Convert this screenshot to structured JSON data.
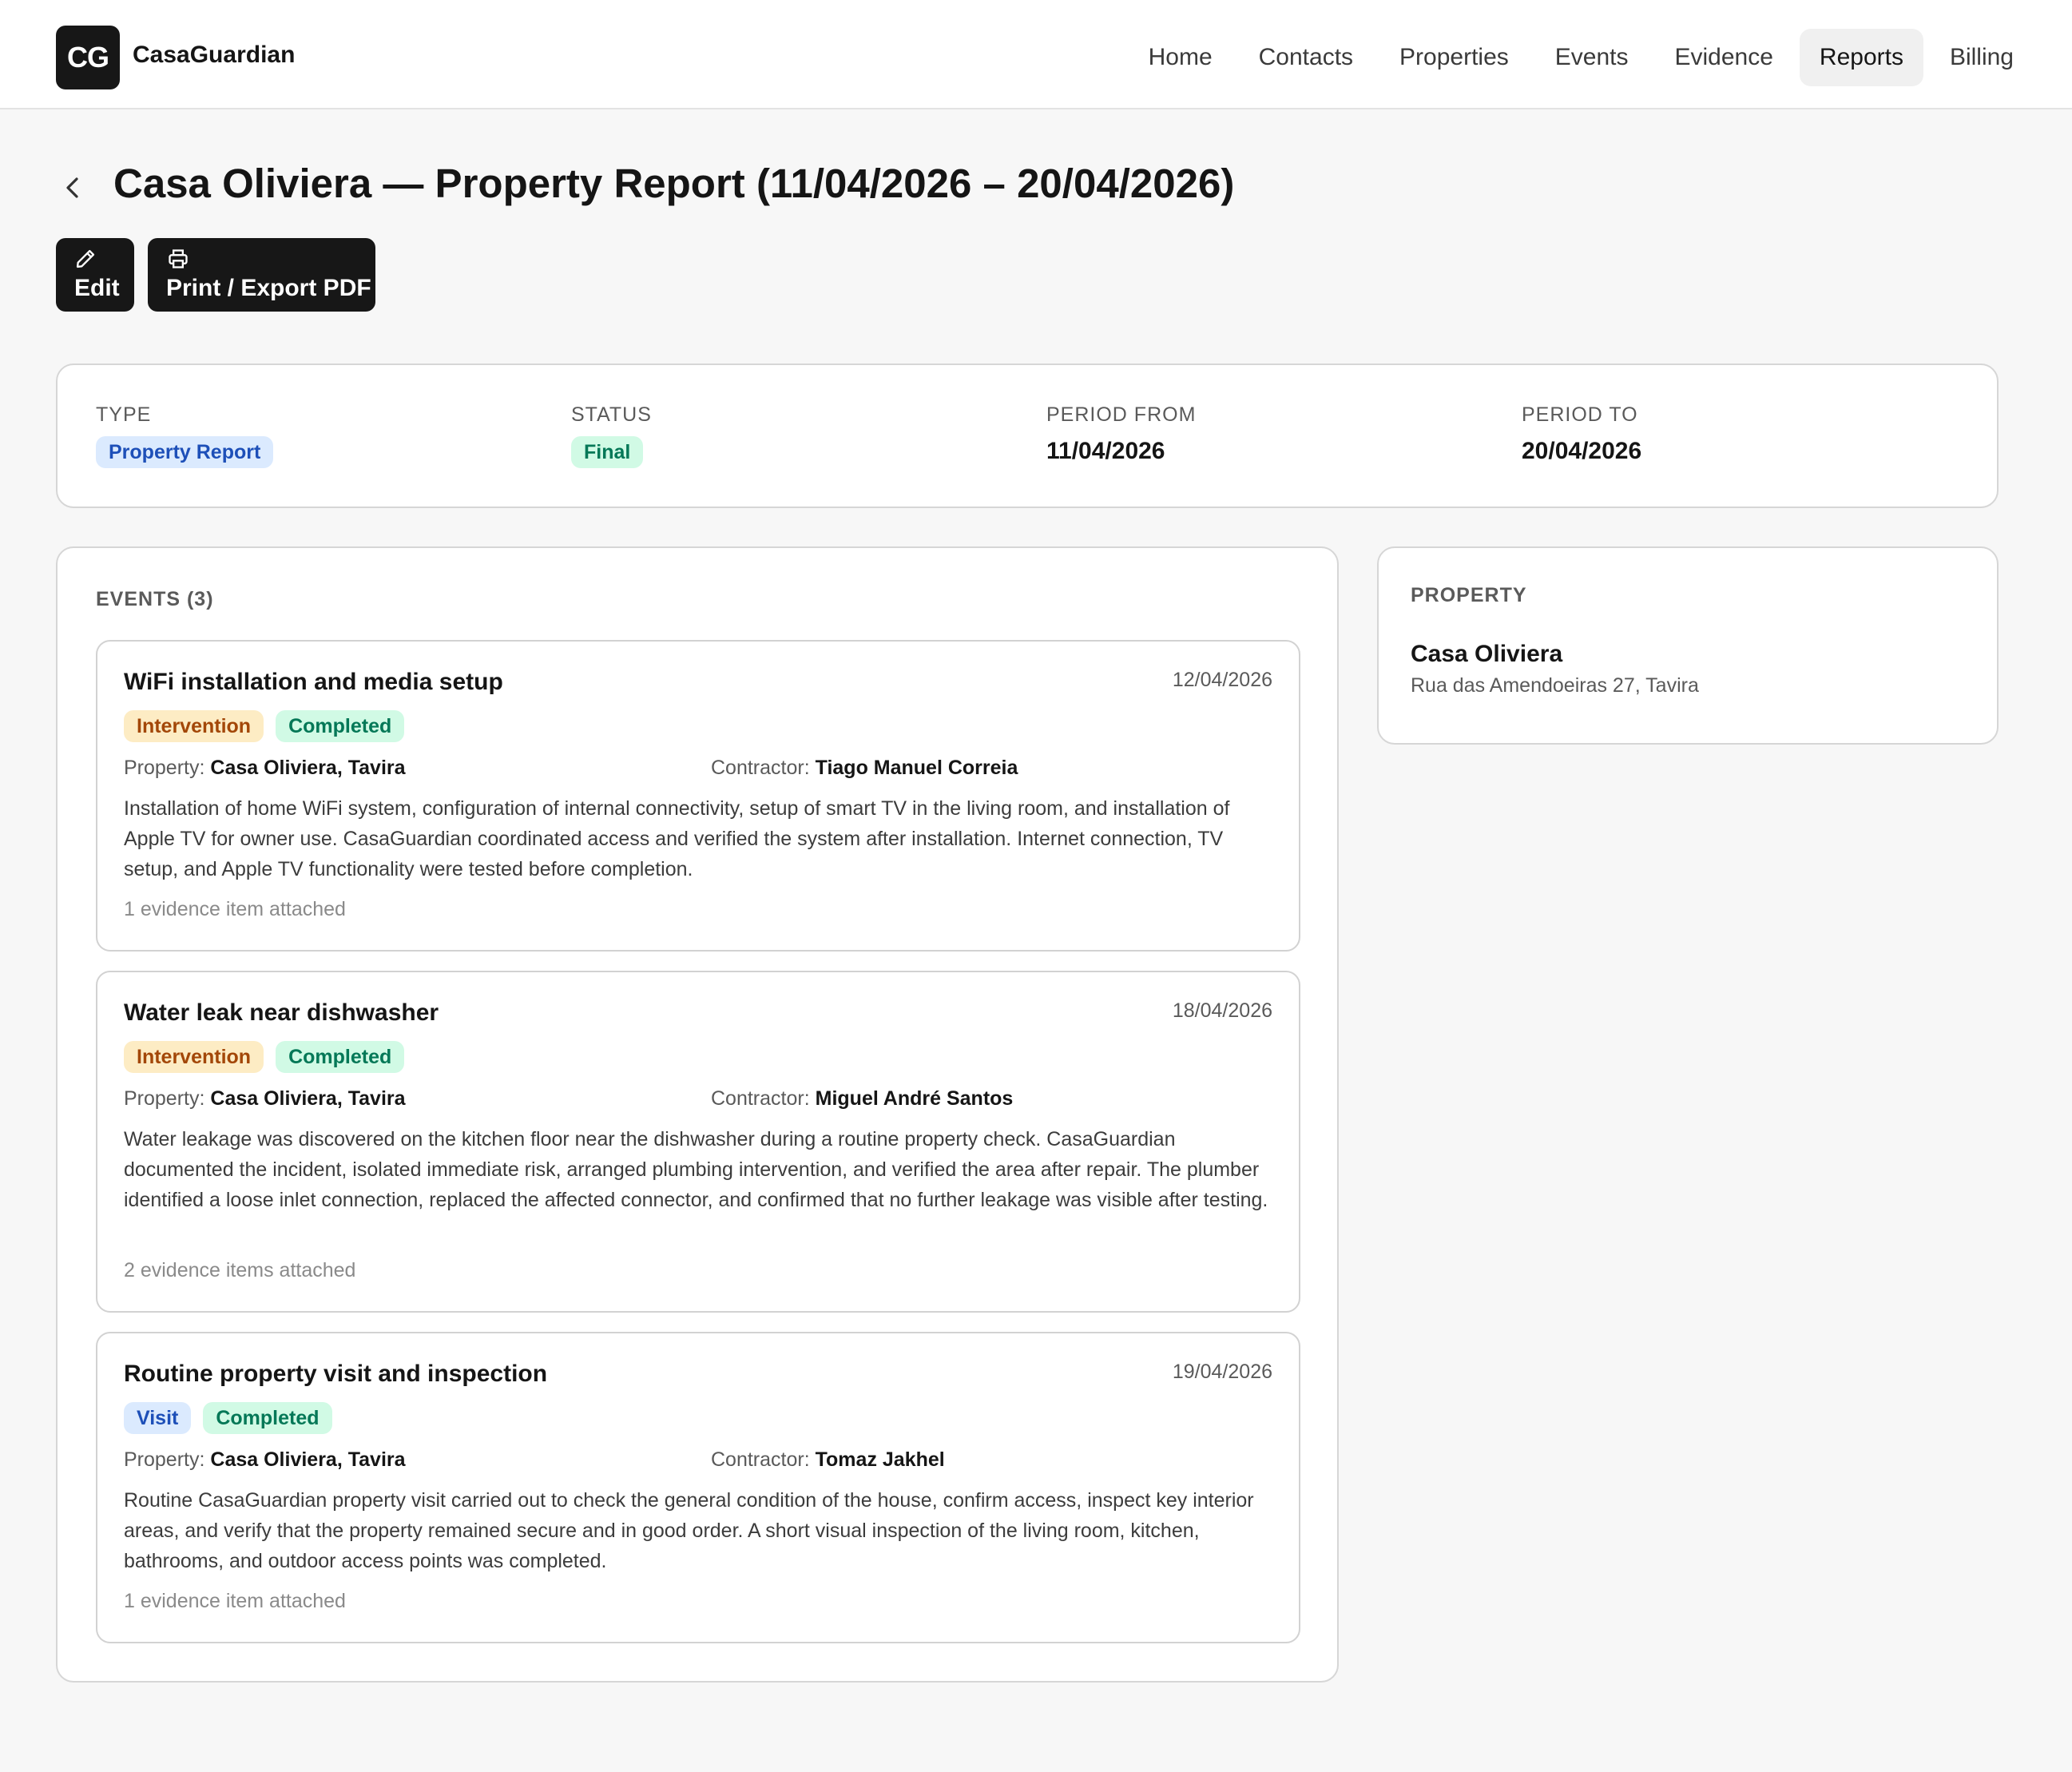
{
  "app": {
    "logo_text": "CG",
    "brand": "CasaGuardian"
  },
  "nav": {
    "items": [
      {
        "label": "Home"
      },
      {
        "label": "Contacts"
      },
      {
        "label": "Properties"
      },
      {
        "label": "Events"
      },
      {
        "label": "Evidence"
      },
      {
        "label": "Reports",
        "active": true
      },
      {
        "label": "Billing"
      }
    ]
  },
  "header": {
    "back_icon": "chevron-left-icon",
    "title": "Casa Oliviera — Property Report (11/04/2026 – 20/04/2026)",
    "edit_label": "Edit",
    "edit_icon": "pencil-icon",
    "print_label": "Print / Export PDF",
    "print_icon": "printer-icon"
  },
  "summary": {
    "type_label": "TYPE",
    "type_value": "Property Report",
    "status_label": "STATUS",
    "status_value": "Final",
    "period_from_label": "PERIOD FROM",
    "period_from_value": "11/04/2026",
    "period_to_label": "PERIOD TO",
    "period_to_value": "20/04/2026"
  },
  "events": {
    "heading": "EVENTS (3)",
    "property_label": "Property:",
    "contractor_label": "Contractor:",
    "items": [
      {
        "title": "WiFi installation and media setup",
        "date": "12/04/2026",
        "category": "Intervention",
        "status": "Completed",
        "property": "Casa Oliviera, Tavira",
        "contractor": "Tiago Manuel Correia",
        "description": "Installation of home WiFi system, configuration of internal connectivity, setup of smart TV in the living room, and installation of Apple TV for owner use. CasaGuardian coordinated access and verified the system after installation. Internet connection, TV setup, and Apple TV functionality were tested before completion.",
        "evidence": "1 evidence item attached"
      },
      {
        "title": "Water leak near dishwasher",
        "date": "18/04/2026",
        "category": "Intervention",
        "status": "Completed",
        "property": "Casa Oliviera, Tavira",
        "contractor": "Miguel André Santos",
        "description": "Water leakage was discovered on the kitchen floor near the dishwasher during a routine property check. CasaGuardian documented the incident, isolated immediate risk, arranged plumbing intervention, and verified the area after repair. The plumber identified a loose inlet connection, replaced the affected connector, and confirmed that no further leakage was visible after testing.",
        "evidence": "2 evidence items attached"
      },
      {
        "title": "Routine property visit and inspection",
        "date": "19/04/2026",
        "category": "Visit",
        "status": "Completed",
        "property": "Casa Oliviera, Tavira",
        "contractor": "Tomaz Jakhel",
        "description": "Routine CasaGuardian property visit carried out to check the general condition of the house, confirm access, inspect key interior areas, and verify that the property remained secure and in good order. A short visual inspection of the living room, kitchen, bathrooms, and outdoor access points was completed.",
        "evidence": "1 evidence item attached"
      }
    ]
  },
  "property": {
    "heading": "PROPERTY",
    "name": "Casa Oliviera",
    "address": "Rua das Amendoeiras 27, Tavira"
  }
}
